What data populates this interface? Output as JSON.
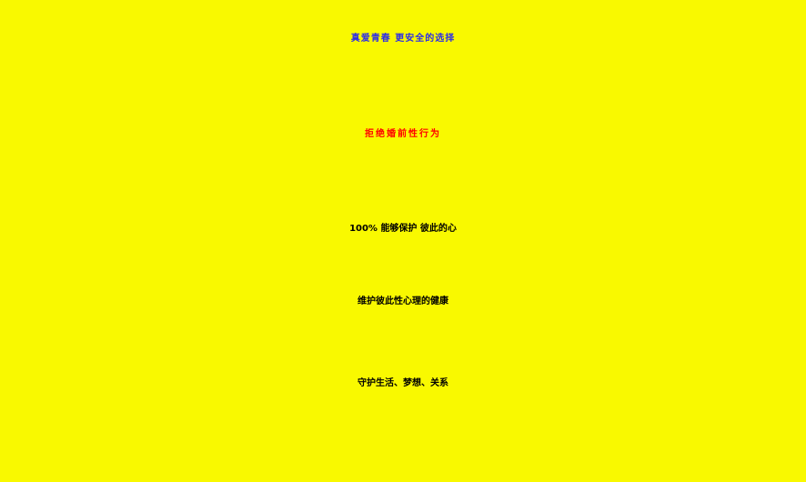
{
  "poster": {
    "line1": "真爱青春 更安全的选择",
    "line2": "拒绝婚前性行为",
    "line3": "100% 能够保护 彼此的心",
    "line4": "维护彼此性心理的健康",
    "line5": "守护生活、梦想、关系"
  },
  "colors": {
    "background": "#f9f900",
    "line1": "#2e2ee6",
    "line2": "#ff0000",
    "body_text": "#000000"
  }
}
